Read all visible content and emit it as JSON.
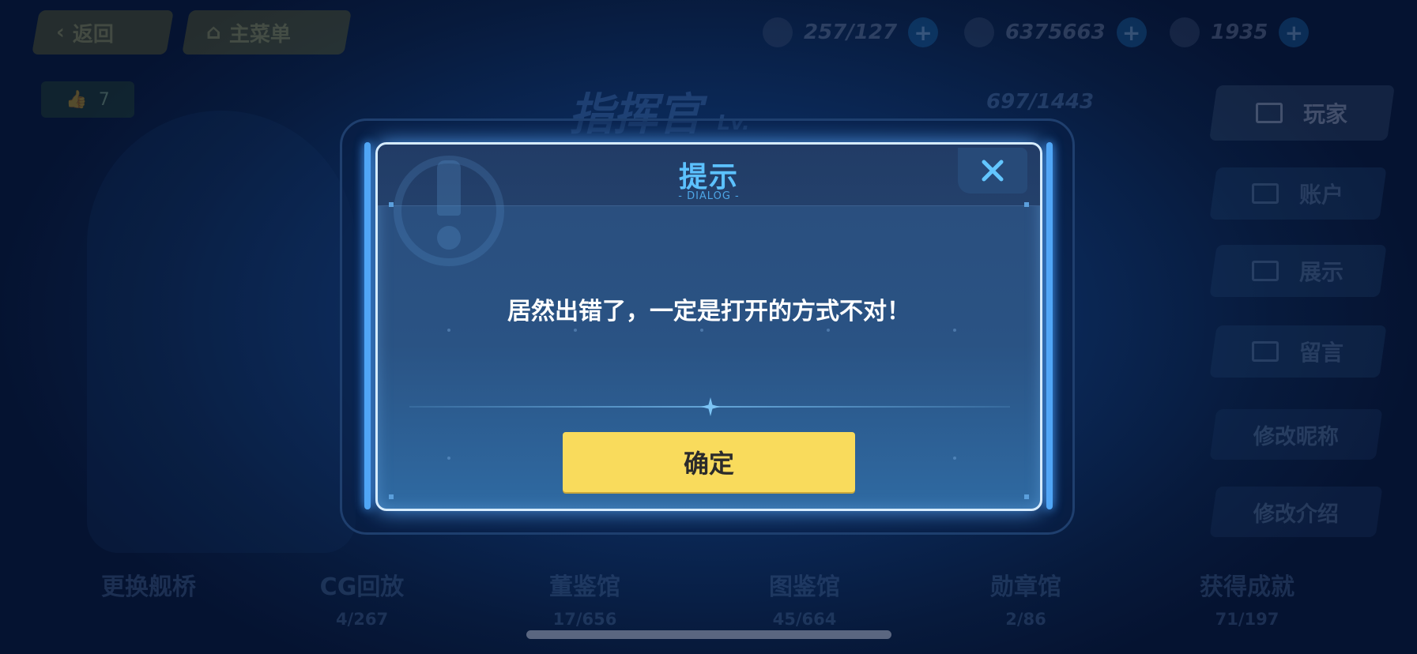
{
  "topbar": {
    "back_label": "返回",
    "home_label": "主菜单",
    "resources": [
      {
        "icon": "stamina-icon",
        "value": "257/127"
      },
      {
        "icon": "coin-icon",
        "value": "6375663"
      },
      {
        "icon": "gem-icon",
        "value": "1935"
      }
    ],
    "plus_symbol": "+"
  },
  "background": {
    "like_count": "7",
    "commander_title": "指挥官",
    "level_suffix": "Lv.",
    "exp_counter": "697/1443",
    "side_menu": [
      "玩家",
      "账户",
      "展示",
      "留言"
    ],
    "edit_buttons": [
      "修改昵称",
      "修改介绍"
    ],
    "stats": [
      {
        "label": "更换舰桥",
        "value": ""
      },
      {
        "label": "CG回放",
        "value": "4/267"
      },
      {
        "label": "董鉴馆",
        "value": "17/656"
      },
      {
        "label": "图鉴馆",
        "value": "45/664"
      },
      {
        "label": "勋章馆",
        "value": "2/86"
      },
      {
        "label": "获得成就",
        "value": "71/197"
      }
    ]
  },
  "dialog": {
    "title": "提示",
    "subtitle": "- DIALOG -",
    "message": "居然出错了，一定是打开的方式不对！",
    "confirm_label": "确定",
    "close_symbol": "✕"
  },
  "colors": {
    "accent_blue": "#5cc1ff",
    "confirm_yellow": "#f9db5c",
    "dialog_border": "#d6ecff"
  }
}
